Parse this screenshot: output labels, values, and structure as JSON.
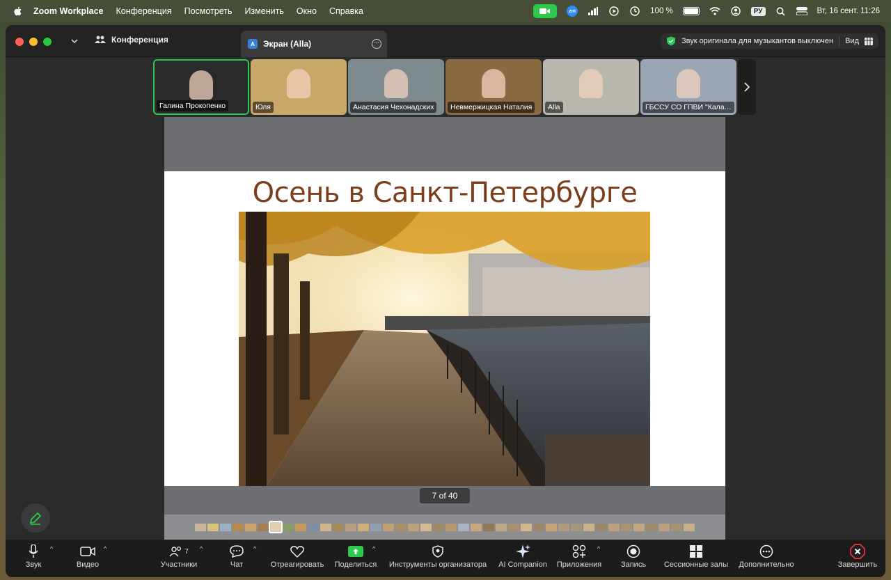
{
  "menubar": {
    "app_name": "Zoom Workplace",
    "items": [
      "Конференция",
      "Посмотреть",
      "Изменить",
      "Окно",
      "Справка"
    ],
    "battery": "100 %",
    "input_lang": "РУ",
    "datetime": "Вт, 16 сент.  11:26"
  },
  "titlebar": {
    "conference_label": "Конференция",
    "tab_label": "Экран (Alla)",
    "tab_badge": "A",
    "original_sound": "Звук оригинала для музыкантов выключен",
    "view_label": "Вид"
  },
  "gallery": [
    {
      "name": "Галина Прокопенко",
      "bg": "#2a2a2a",
      "active": true
    },
    {
      "name": "Юля",
      "bg": "#c9a86a"
    },
    {
      "name": "Анастасия Чехонадских",
      "bg": "#7d8a8e"
    },
    {
      "name": "Невмержицкая Наталия",
      "bg": "#8a6a42"
    },
    {
      "name": "Alla",
      "bg": "#b9b6ad"
    },
    {
      "name": "ГБССУ СО ГПВИ \"Калачинский ПНИ\"",
      "bg": "#9aa6b3"
    }
  ],
  "slide": {
    "title": "Осень в Санкт-Петербурге",
    "page_indicator": "7 of 40"
  },
  "filmstrip": {
    "colors": [
      "#c8b59a",
      "#d8c27a",
      "#9db0c2",
      "#b8894f",
      "#caa36b",
      "#a67c52",
      "#e0d0b0",
      "#8a9a6a",
      "#c49a5a",
      "#7e8fa3",
      "#d2b48c",
      "#a68b5b",
      "#b4a080",
      "#cfae7a",
      "#90a0b0",
      "#c0a070",
      "#a88f6a",
      "#bba27a",
      "#d4b890",
      "#9e8a66",
      "#b89870",
      "#a4b4c4",
      "#c8a87a",
      "#8e7a5a",
      "#bca884",
      "#a89070",
      "#d0b88c",
      "#9a8868",
      "#c4a478",
      "#b09c7c",
      "#a6967a",
      "#c8b08a",
      "#98886c",
      "#bca07c",
      "#aa9470",
      "#c0a880",
      "#9c8c70",
      "#b8a07a",
      "#a49474",
      "#c6ae86"
    ],
    "current_index": 6
  },
  "toolbar": {
    "audio": "Звук",
    "video": "Видео",
    "participants": "Участники",
    "participants_count": "7",
    "chat": "Чат",
    "react": "Отреагировать",
    "share": "Поделиться",
    "host_tools": "Инструменты организатора",
    "ai_companion": "AI Companion",
    "apps": "Приложения",
    "record": "Запись",
    "breakout": "Сессионные залы",
    "more": "Дополнительно",
    "end": "Завершить"
  },
  "colors": {
    "accent_green": "#2fc84f",
    "end_red": "#e0383e",
    "toolbar_bg": "#1c1c1c"
  }
}
